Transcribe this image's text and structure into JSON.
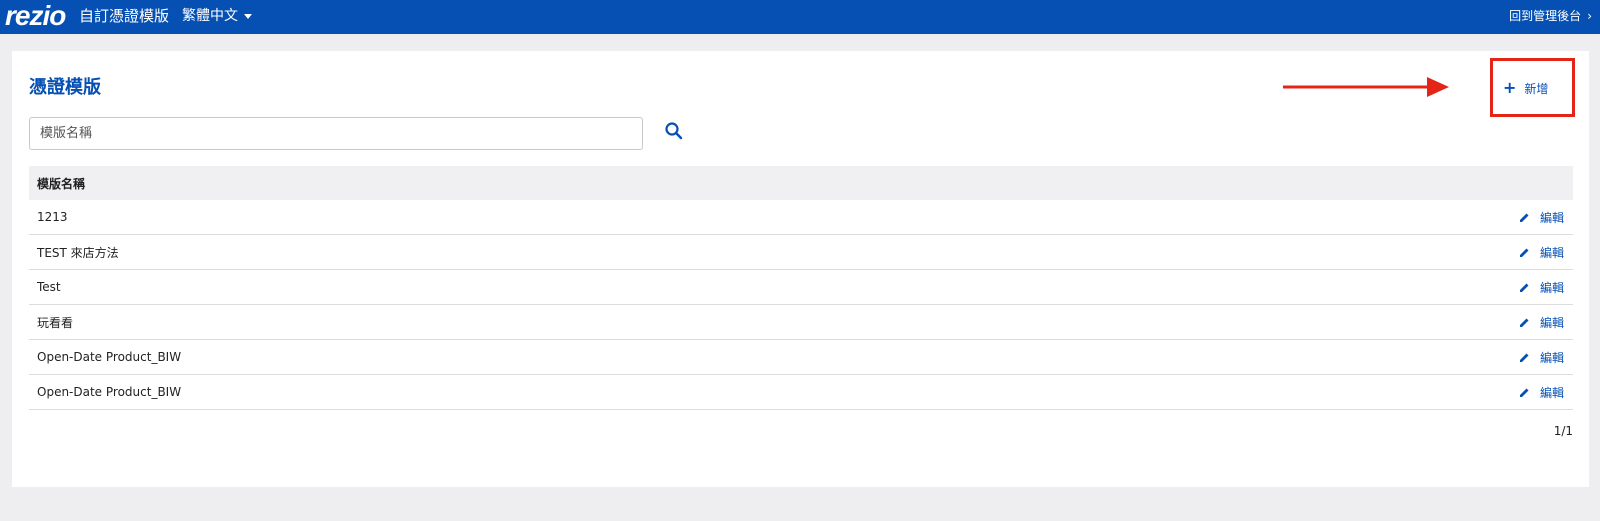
{
  "topbar": {
    "logo": "rezio",
    "app_title": "自訂憑證模版",
    "language": "繁體中文",
    "back_link": "回到管理後台",
    "back_chevron": "›"
  },
  "page": {
    "title": "憑證模版",
    "add_icon": "+",
    "add_label": "新增"
  },
  "search": {
    "placeholder": "模版名稱",
    "value": ""
  },
  "table": {
    "header": "模版名稱",
    "edit_label": "編輯",
    "rows": [
      {
        "name": "1213"
      },
      {
        "name": "TEST 來店方法"
      },
      {
        "name": "Test"
      },
      {
        "name": "玩看看"
      },
      {
        "name": "Open-Date Product_BIW"
      },
      {
        "name": "Open-Date Product_BIW"
      }
    ]
  },
  "pagination": "1/1",
  "colors": {
    "brand": "#0650b4",
    "annotation": "#e32417"
  },
  "icons": {
    "search": "search-icon",
    "edit": "pencil-icon",
    "add": "plus-icon",
    "caret": "caret-down-icon",
    "chevron": "chevron-right-icon"
  }
}
